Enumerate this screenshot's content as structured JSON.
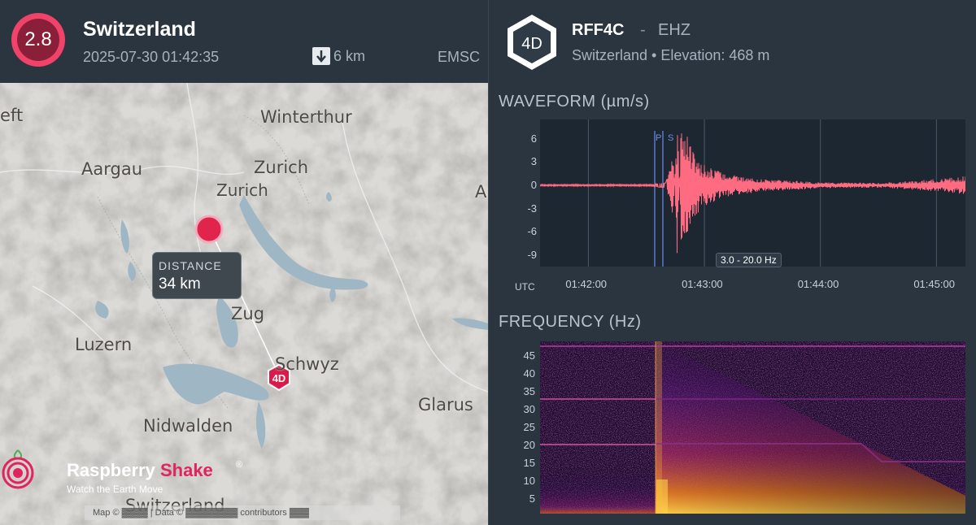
{
  "event": {
    "magnitude": "2.8",
    "region": "Switzerland",
    "datetime": "2025-07-30 01:42:35",
    "depth": "6 km",
    "source": "EMSC"
  },
  "map": {
    "places": {
      "winterthur": "Winterthur",
      "aargau": "Aargau",
      "zurich_canton": "Zurich",
      "zurich_city": "Zurich",
      "zug": "Zug",
      "luzern": "Luzern",
      "schwyz": "Schwyz",
      "nidwalden": "Nidwalden",
      "glarus": "Glarus",
      "switzerland": "Switzerland",
      "edge_left": "eft",
      "edge_right": "A"
    },
    "distance_label": "DISTANCE",
    "distance_value": "34 km",
    "station_marker": "4D",
    "brand_raspberry": "Raspberry",
    "brand_shake": "Shake",
    "brand_tagline": "Watch the Earth Move",
    "brand_reg": "®",
    "attribution": "Map © ▓▓▓▓ | Data © ▓▓▓▓▓▓▓▓ contributors ▓▓▓",
    "colors": {
      "event_marker": "#e0244c",
      "station_marker": "#d91a4a",
      "water": "#9fb6c4"
    }
  },
  "station": {
    "network": "4D",
    "id": "RFF4C",
    "separator": "-",
    "channel": "EHZ",
    "location": "Switzerland • Elevation: 468 m"
  },
  "waveform": {
    "title": "WAVEFORM (µm/s)",
    "y_ticks": [
      "6",
      "3",
      "0",
      "-3",
      "-6",
      "-9"
    ],
    "x_ticks": [
      "01:42:00",
      "01:43:00",
      "01:44:00",
      "01:45:00"
    ],
    "x_axis_label": "UTC",
    "filter": "3.0 - 20.0 Hz",
    "p_label": "P",
    "s_label": "S",
    "color": "#ff6b81"
  },
  "spectrogram": {
    "title": "FREQUENCY (Hz)",
    "y_ticks": [
      "45",
      "40",
      "35",
      "30",
      "25",
      "20",
      "15",
      "10",
      "5"
    ]
  },
  "chart_data": [
    {
      "type": "line",
      "title": "WAVEFORM (µm/s)",
      "xlabel": "UTC",
      "ylabel": "µm/s",
      "x_ticks": [
        "01:42:00",
        "01:43:00",
        "01:44:00",
        "01:45:00"
      ],
      "ylim": [
        -10.5,
        8.5
      ],
      "series": [
        {
          "x": [
            "01:41:35",
            "01:42:30",
            "01:42:40",
            "01:42:44",
            "01:42:46",
            "01:42:48",
            "01:42:52",
            "01:42:58",
            "01:43:10",
            "01:43:30",
            "01:44:00",
            "01:44:30",
            "01:45:00",
            "01:45:15"
          ],
          "values": [
            0.1,
            0.1,
            0.3,
            4.5,
            -10.0,
            8.5,
            6.0,
            3.0,
            1.5,
            0.8,
            0.4,
            0.3,
            0.8,
            1.2
          ]
        }
      ]
    },
    {
      "type": "heatmap",
      "title": "FREQUENCY (Hz)",
      "ylabel": "Hz",
      "ylim": [
        1,
        49
      ],
      "y_ticks": [
        5,
        10,
        15,
        20,
        25,
        30,
        35,
        40,
        45
      ]
    }
  ]
}
